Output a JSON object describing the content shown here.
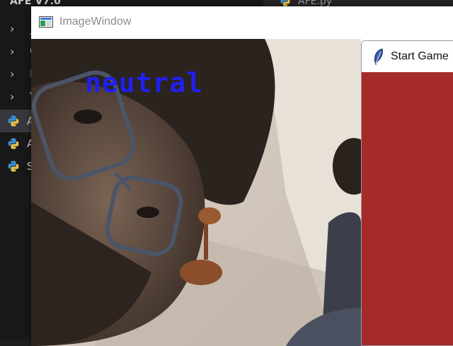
{
  "explorer": {
    "folder_title": "AFE V7.0",
    "items": [
      {
        "label": "_",
        "kind": "folder"
      },
      {
        "label": "C",
        "kind": "folder"
      },
      {
        "label": "P",
        "kind": "folder"
      },
      {
        "label": "V",
        "kind": "folder"
      },
      {
        "label": "A",
        "kind": "python-file"
      },
      {
        "label": "A",
        "kind": "python-file"
      },
      {
        "label": "S",
        "kind": "python-file"
      }
    ]
  },
  "editor": {
    "tab_label": "AFE.py"
  },
  "image_window": {
    "title": "ImageWindow",
    "overlay_label": "neutral",
    "overlay_color": "#1f1fef"
  },
  "game_window": {
    "title": "Start Game",
    "icon": "feather-icon",
    "body_color": "#a52a2a"
  }
}
